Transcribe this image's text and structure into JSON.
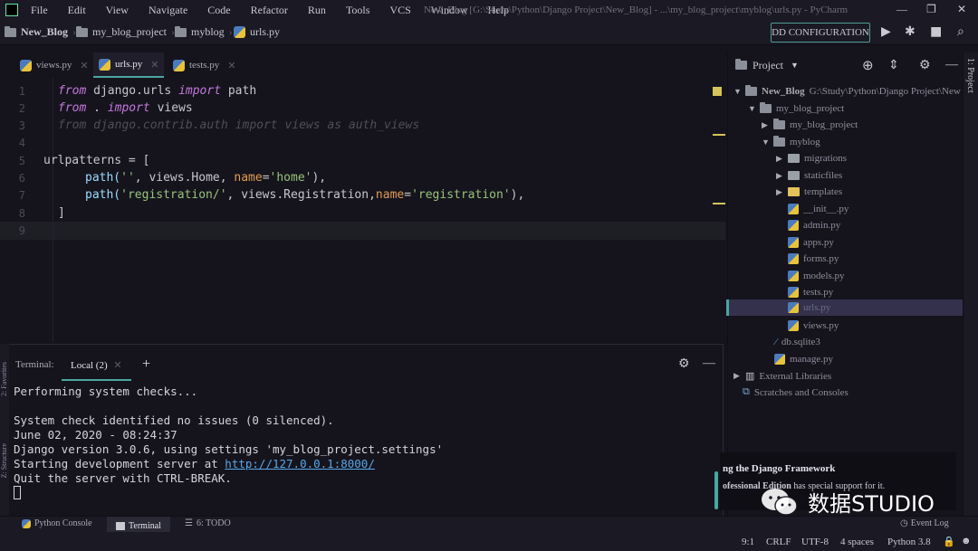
{
  "menu": [
    "File",
    "Edit",
    "View",
    "Navigate",
    "Code",
    "Refactor",
    "Run",
    "Tools",
    "VCS",
    "Window",
    "Help"
  ],
  "window_title": "New_Blog [G:\\Study\\Python\\Django Project\\New_Blog] - ...\\my_blog_project\\myblog\\urls.py - PyCharm",
  "breadcrumbs": [
    "New_Blog",
    "my_blog_project",
    "myblog",
    "urls.py"
  ],
  "run_config_label": "DD CONFIGURATION",
  "tabs": [
    {
      "label": "views.py"
    },
    {
      "label": "urls.py"
    },
    {
      "label": "tests.py"
    }
  ],
  "editor": {
    "line_numbers": [
      "1",
      "2",
      "3",
      "4",
      "5",
      "6",
      "7",
      "8",
      "9"
    ],
    "code": {
      "l1": [
        "from",
        " django.urls ",
        "import",
        " path"
      ],
      "l2": [
        "from",
        " . ",
        "import",
        " views"
      ],
      "l3": "from django.contrib.auth import views as auth_views",
      "l5": "urlpatterns = [",
      "l6": [
        "path(",
        "''",
        ", views.Home, ",
        "name",
        "=",
        "'home'",
        "),"
      ],
      "l7": [
        "path(",
        "'registration/'",
        ", views.Registration,",
        "name",
        "=",
        "'registration'",
        "),"
      ],
      "l8": "]"
    }
  },
  "project": {
    "header": "Project",
    "root_name": "New_Blog",
    "root_path": "G:\\Study\\Python\\Django Project\\New",
    "items": [
      {
        "label": "my_blog_project"
      },
      {
        "label": "my_blog_project"
      },
      {
        "label": "myblog"
      },
      {
        "label": "migrations"
      },
      {
        "label": "staticfiles"
      },
      {
        "label": "templates"
      },
      {
        "label": "__init__.py"
      },
      {
        "label": "admin.py"
      },
      {
        "label": "apps.py"
      },
      {
        "label": "forms.py"
      },
      {
        "label": "models.py"
      },
      {
        "label": "tests.py"
      },
      {
        "label": "urls.py"
      },
      {
        "label": "views.py"
      },
      {
        "label": "db.sqlite3"
      },
      {
        "label": "manage.py"
      },
      {
        "label": "External Libraries"
      },
      {
        "label": "Scratches and Consoles"
      }
    ],
    "side_tab": "1: Project"
  },
  "terminal": {
    "label": "Terminal:",
    "tab": "Local (2)",
    "lines": [
      "Performing system checks...",
      "System check identified no issues (0 silenced).",
      "June 02, 2020 - 08:24:37",
      "Django version 3.0.6, using settings 'my_blog_project.settings'",
      "Starting development server at ",
      "Quit the server with CTRL-BREAK."
    ],
    "link": "http://127.0.0.1:8000/"
  },
  "left_strip": [
    "2: Favorites",
    "Z: Structure"
  ],
  "notification": {
    "title": "ng the Django Framework",
    "body_bold": "ofessional Edition",
    "body_rest": " has special support for it."
  },
  "watermark": "数据STUDIO",
  "bottom_tabs": [
    "Python Console",
    "Terminal",
    "6: TODO"
  ],
  "event_log": "Event Log",
  "status": {
    "position": "9:1",
    "line_sep": "CRLF",
    "encoding": "UTF-8",
    "indent": "4 spaces",
    "interpreter": "Python 3.8"
  }
}
